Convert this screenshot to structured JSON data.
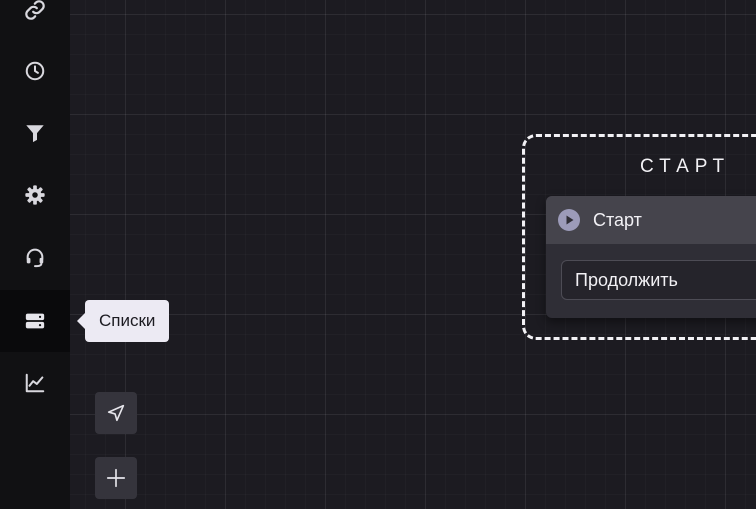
{
  "sidebar": {
    "items": [
      {
        "icon": "link-icon"
      },
      {
        "icon": "clock-icon"
      },
      {
        "icon": "filter-icon"
      },
      {
        "icon": "gear-icon"
      },
      {
        "icon": "headset-icon"
      },
      {
        "icon": "lists-icon",
        "active": true
      },
      {
        "icon": "chart-line-icon"
      }
    ]
  },
  "tooltip": {
    "text": "Списки"
  },
  "tools": [
    {
      "icon": "navigation-arrow-icon"
    },
    {
      "icon": "plus-icon"
    }
  ],
  "canvas": {
    "group": {
      "title": "СТАРТ",
      "node": {
        "icon": "play-circle-icon",
        "title": "Старт",
        "button_label": "Продолжить"
      }
    }
  },
  "colors": {
    "sidebar_bg": "#111113",
    "canvas_bg": "#1c1b21",
    "icon": "#d9d8de",
    "tooltip_bg": "#eceaf3",
    "node_header": "#45444c",
    "node_body": "#2f2e36",
    "play_icon": "#9c9bb9"
  }
}
